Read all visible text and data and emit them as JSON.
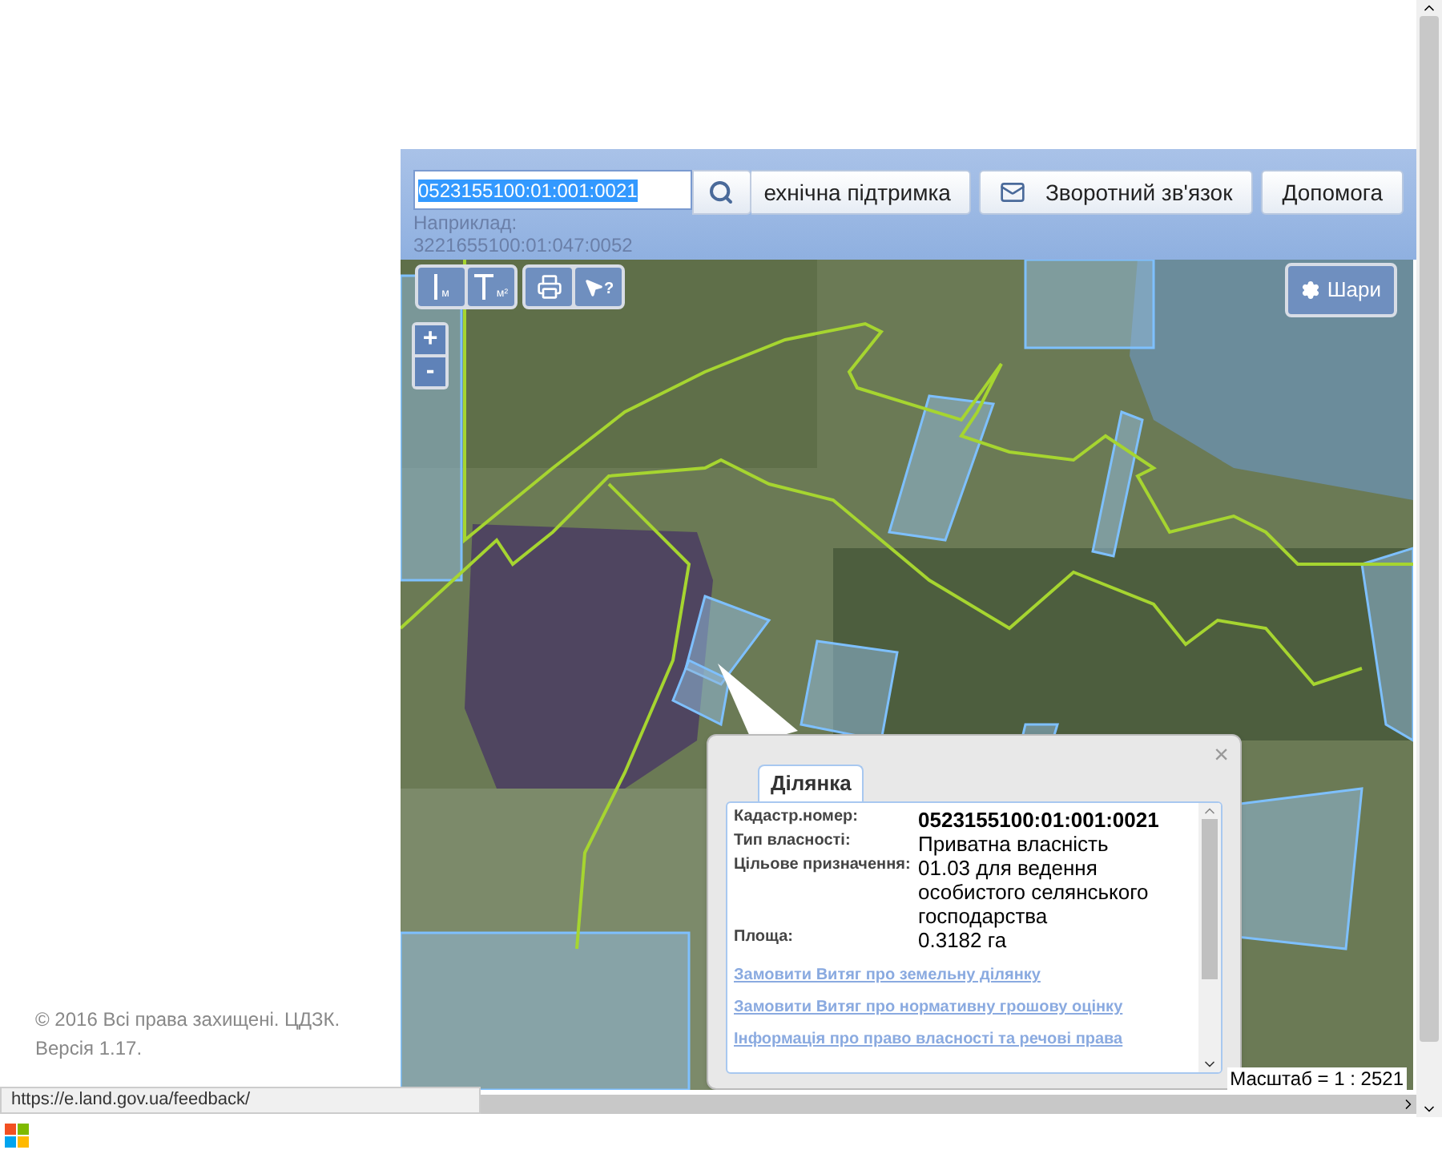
{
  "header": {
    "search": {
      "value": "0523155100:01:001:0021",
      "selected": true
    },
    "hint_label": "Наприклад:",
    "hint_example": "3221655100:01:047:0052",
    "buttons": [
      {
        "kind": "support",
        "label": "ехнічна підтримка"
      },
      {
        "kind": "mail",
        "label": "Зворотний зв'язок"
      },
      {
        "kind": "plain",
        "label": "Допомога"
      }
    ]
  },
  "map": {
    "tools": [
      {
        "kind": "ruler",
        "sub": "м"
      },
      {
        "kind": "area",
        "sub": "м²"
      },
      {
        "kind": "print"
      },
      {
        "kind": "info",
        "sub": "?"
      }
    ],
    "layers_button": "Шари",
    "zoom": [
      "+",
      "-"
    ],
    "scale": "Масштаб = 1 : 2521"
  },
  "popup": {
    "close": "×",
    "tab": {
      "label": "Ділянка",
      "selected": true
    },
    "fields": [
      {
        "label": "Кадастр.номер:",
        "value": "0523155100:01:001:0021",
        "bold": true
      },
      {
        "label": "Тип власності:",
        "value": "Приватна власність",
        "bold": false
      },
      {
        "label": "Цільове призначення:",
        "value": "01.03 для ведення особистого селянського господарства",
        "bold": false
      },
      {
        "label": "Площа:",
        "value": "0.3182 га",
        "bold": false
      }
    ],
    "links": [
      "Замовити Витяг про земельну ділянку",
      "Замовити Витяг про нормативну грошову оцінку",
      "Інформація про право власності та речові права"
    ]
  },
  "footer": {
    "copyright": "© 2016 Всі права захищені. ЦДЗК.",
    "version": "Версія 1.17."
  },
  "status_bar": {
    "url": "https://e.land.gov.ua/feedback/"
  }
}
